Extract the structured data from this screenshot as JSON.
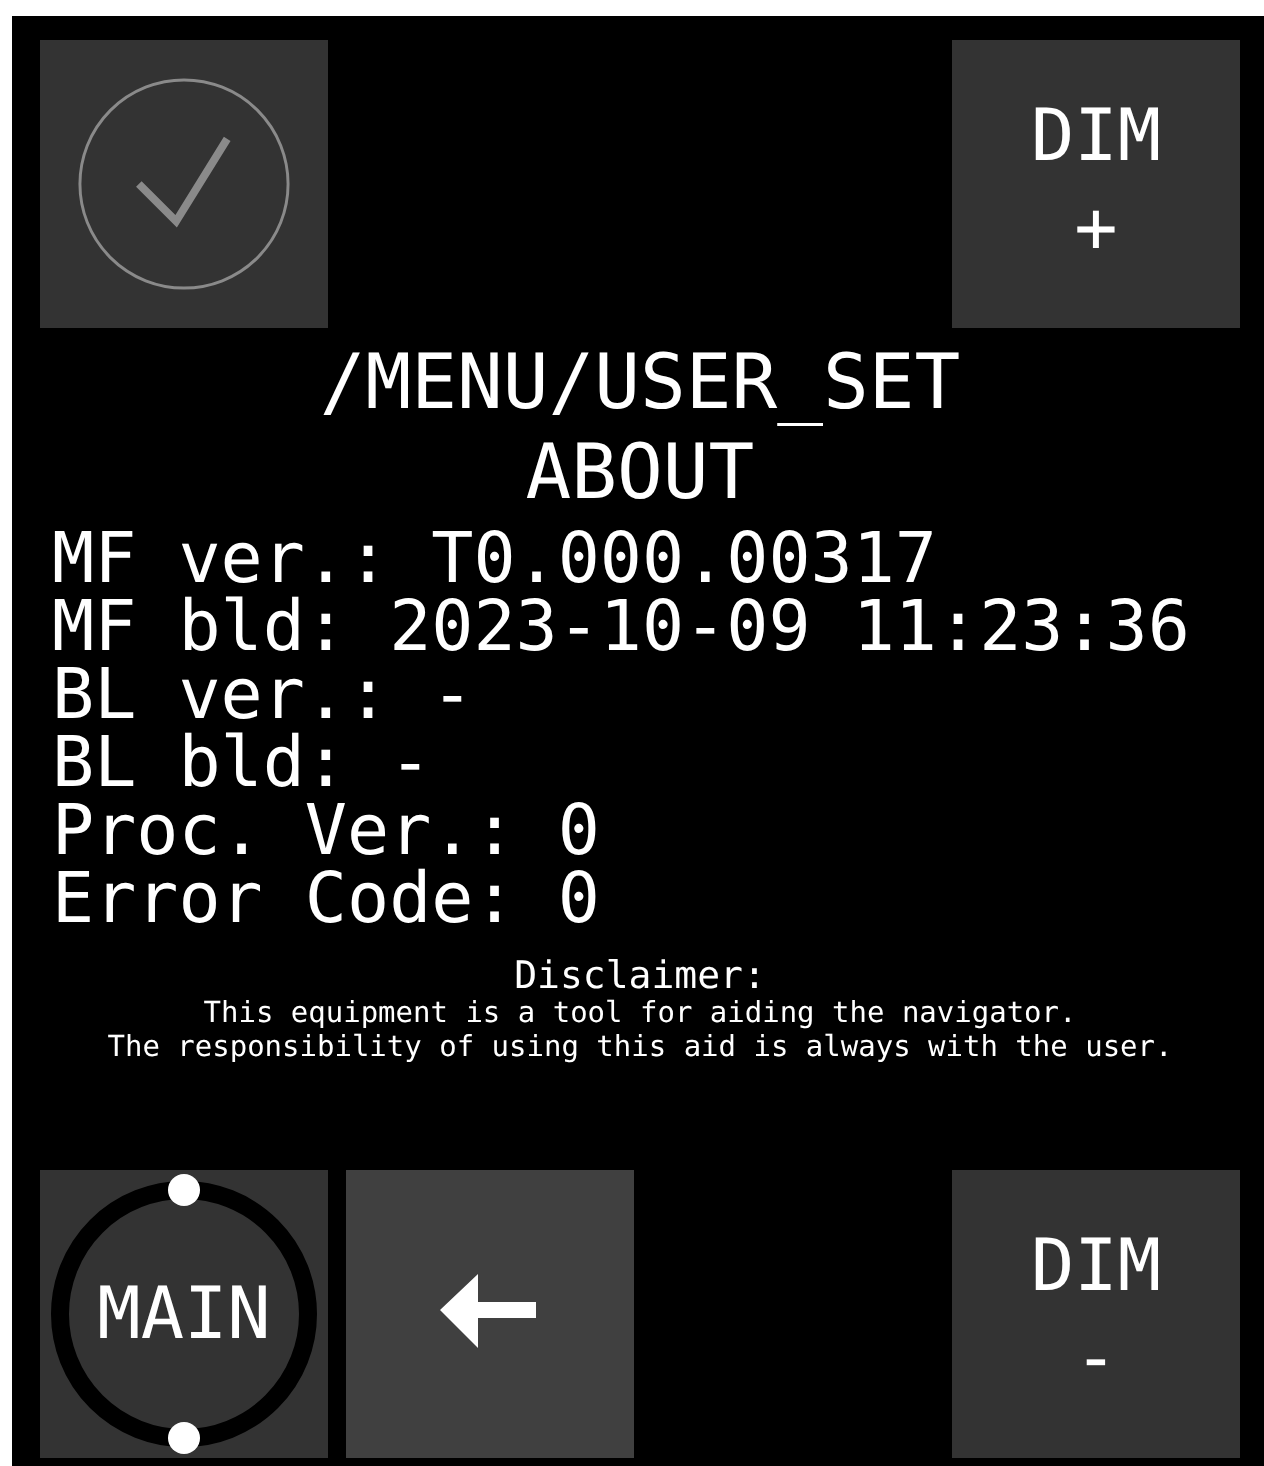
{
  "confirm_button": {
    "disabled": true
  },
  "dim_up_button": {
    "label": "DIM",
    "sign": "+"
  },
  "path": "/MENU/USER_SET",
  "title": "ABOUT",
  "info_lines": [
    "MF ver.: T0.000.00317",
    "MF bld: 2023-10-09 11:23:36",
    "BL ver.: -",
    "BL bld: -",
    "Proc. Ver.: 0",
    "Error Code: 0"
  ],
  "disclaimer": {
    "heading": "Disclaimer:",
    "lines": [
      "This equipment is a tool for aiding the navigator.",
      "The responsibility of using this aid is always with the user."
    ]
  },
  "main_button": {
    "label": "MAIN"
  },
  "dim_down_button": {
    "label": "DIM",
    "sign": "-"
  }
}
